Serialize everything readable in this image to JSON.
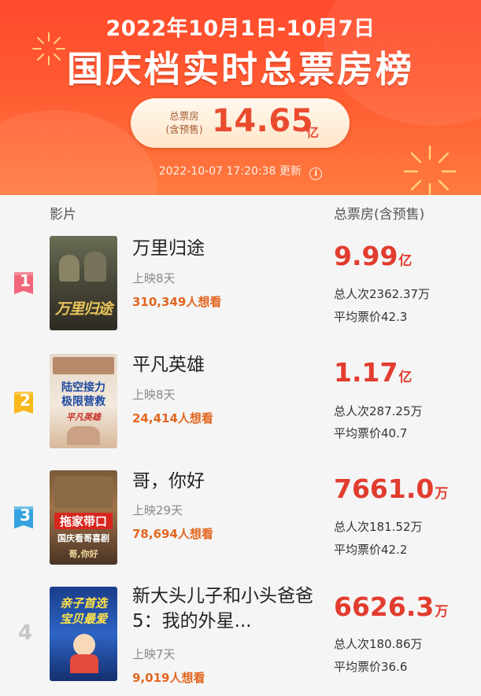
{
  "header": {
    "date_range": "2022年10月1日-10月7日",
    "title": "国庆档实时总票房榜",
    "total": {
      "label_line1": "总票房",
      "label_line2": "(含预售)",
      "value": "14.65",
      "unit": "亿"
    },
    "update_time": "2022-10-07 17:20:38",
    "update_label": "更新",
    "info_icon": "i"
  },
  "columns": {
    "film": "影片",
    "box_office": "总票房(含预售)"
  },
  "colors": {
    "header_red": "#ff4a2c",
    "box_value_red": "#e23c2e",
    "want_orange": "#e2661f",
    "rank1": "#f1667a",
    "rank2": "#f8b81a",
    "rank3": "#36a3e0"
  },
  "movies": [
    {
      "rank": "1",
      "title": "万里归途",
      "release": "上映8天",
      "want": "310,349人想看",
      "box_value": "9.99",
      "box_unit": "亿",
      "admissions": "总人次2362.37万",
      "avg_price": "平均票价42.3",
      "poster_text": "万里归途",
      "poster_icon": "poster-wanli"
    },
    {
      "rank": "2",
      "title": "平凡英雄",
      "release": "上映8天",
      "want": "24,414人想看",
      "box_value": "1.17",
      "box_unit": "亿",
      "admissions": "总人次287.25万",
      "avg_price": "平均票价40.7",
      "poster_text_1": "陆空接力",
      "poster_text_2": "极限营救",
      "poster_text_3": "平凡英雄"
    },
    {
      "rank": "3",
      "title": "哥，你好",
      "release": "上映29天",
      "want": "78,694人想看",
      "box_value": "7661.0",
      "box_unit": "万",
      "admissions": "总人次181.52万",
      "avg_price": "平均票价42.2",
      "poster_text_1": "拖家带口",
      "poster_text_2": "国庆看哥喜剧",
      "poster_text_3": "哥,你好"
    },
    {
      "rank": "4",
      "title": "新大头儿子和小头爸爸5：我的外星...",
      "release": "上映7天",
      "want": "9,019人想看",
      "box_value": "6626.3",
      "box_unit": "万",
      "admissions": "总人次180.86万",
      "avg_price": "平均票价36.6",
      "poster_text_1": "亲子首选",
      "poster_text_2": "宝贝最爱"
    }
  ]
}
